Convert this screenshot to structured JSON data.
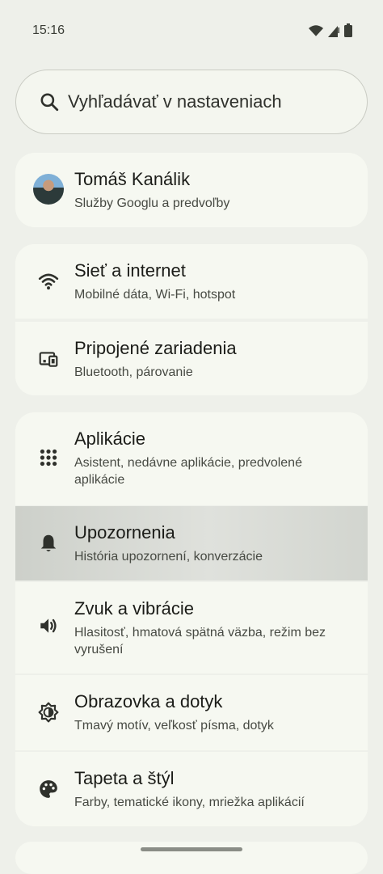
{
  "status": {
    "time": "15:16",
    "icons": [
      "wifi-icon",
      "cell-signal-icon",
      "battery-icon"
    ]
  },
  "search": {
    "placeholder": "Vyhľadávať v nastaveniach"
  },
  "account": {
    "name": "Tomáš Kanálik",
    "subtitle": "Služby Googlu a predvoľby"
  },
  "items": [
    {
      "title": "Sieť a internet",
      "subtitle": "Mobilné dáta, Wi‑Fi, hotspot",
      "icon": "wifi-icon"
    },
    {
      "title": "Pripojené zariadenia",
      "subtitle": "Bluetooth, párovanie",
      "icon": "devices-icon"
    },
    {
      "title": "Aplikácie",
      "subtitle": "Asistent, nedávne aplikácie, predvolené aplikácie",
      "icon": "apps-grid-icon"
    },
    {
      "title": "Upozornenia",
      "subtitle": "História upozornení, konverzácie",
      "icon": "bell-icon",
      "selected": true
    },
    {
      "title": "Zvuk a vibrácie",
      "subtitle": "Hlasitosť, hmatová spätná väzba, režim bez vyrušení",
      "icon": "volume-icon"
    },
    {
      "title": "Obrazovka a dotyk",
      "subtitle": "Tmavý motív, veľkosť písma, dotyk",
      "icon": "brightness-icon"
    },
    {
      "title": "Tapeta a štýl",
      "subtitle": "Farby, tematické ikony, mriežka aplikácií",
      "icon": "palette-icon"
    }
  ]
}
